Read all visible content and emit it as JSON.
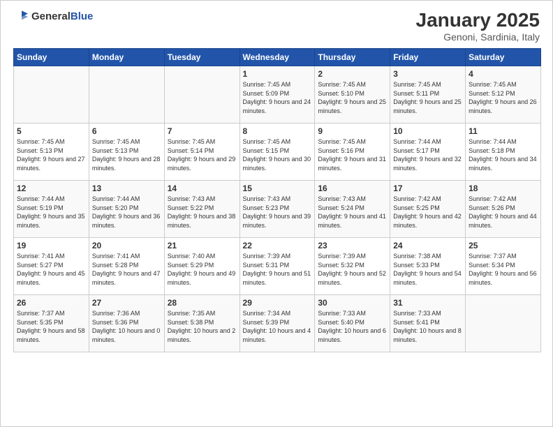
{
  "header": {
    "logo_general": "General",
    "logo_blue": "Blue",
    "month_title": "January 2025",
    "location": "Genoni, Sardinia, Italy"
  },
  "days_of_week": [
    "Sunday",
    "Monday",
    "Tuesday",
    "Wednesday",
    "Thursday",
    "Friday",
    "Saturday"
  ],
  "weeks": [
    [
      {
        "day": "",
        "content": ""
      },
      {
        "day": "",
        "content": ""
      },
      {
        "day": "",
        "content": ""
      },
      {
        "day": "1",
        "content": "Sunrise: 7:45 AM\nSunset: 5:09 PM\nDaylight: 9 hours\nand 24 minutes."
      },
      {
        "day": "2",
        "content": "Sunrise: 7:45 AM\nSunset: 5:10 PM\nDaylight: 9 hours\nand 25 minutes."
      },
      {
        "day": "3",
        "content": "Sunrise: 7:45 AM\nSunset: 5:11 PM\nDaylight: 9 hours\nand 25 minutes."
      },
      {
        "day": "4",
        "content": "Sunrise: 7:45 AM\nSunset: 5:12 PM\nDaylight: 9 hours\nand 26 minutes."
      }
    ],
    [
      {
        "day": "5",
        "content": "Sunrise: 7:45 AM\nSunset: 5:13 PM\nDaylight: 9 hours\nand 27 minutes."
      },
      {
        "day": "6",
        "content": "Sunrise: 7:45 AM\nSunset: 5:13 PM\nDaylight: 9 hours\nand 28 minutes."
      },
      {
        "day": "7",
        "content": "Sunrise: 7:45 AM\nSunset: 5:14 PM\nDaylight: 9 hours\nand 29 minutes."
      },
      {
        "day": "8",
        "content": "Sunrise: 7:45 AM\nSunset: 5:15 PM\nDaylight: 9 hours\nand 30 minutes."
      },
      {
        "day": "9",
        "content": "Sunrise: 7:45 AM\nSunset: 5:16 PM\nDaylight: 9 hours\nand 31 minutes."
      },
      {
        "day": "10",
        "content": "Sunrise: 7:44 AM\nSunset: 5:17 PM\nDaylight: 9 hours\nand 32 minutes."
      },
      {
        "day": "11",
        "content": "Sunrise: 7:44 AM\nSunset: 5:18 PM\nDaylight: 9 hours\nand 34 minutes."
      }
    ],
    [
      {
        "day": "12",
        "content": "Sunrise: 7:44 AM\nSunset: 5:19 PM\nDaylight: 9 hours\nand 35 minutes."
      },
      {
        "day": "13",
        "content": "Sunrise: 7:44 AM\nSunset: 5:20 PM\nDaylight: 9 hours\nand 36 minutes."
      },
      {
        "day": "14",
        "content": "Sunrise: 7:43 AM\nSunset: 5:22 PM\nDaylight: 9 hours\nand 38 minutes."
      },
      {
        "day": "15",
        "content": "Sunrise: 7:43 AM\nSunset: 5:23 PM\nDaylight: 9 hours\nand 39 minutes."
      },
      {
        "day": "16",
        "content": "Sunrise: 7:43 AM\nSunset: 5:24 PM\nDaylight: 9 hours\nand 41 minutes."
      },
      {
        "day": "17",
        "content": "Sunrise: 7:42 AM\nSunset: 5:25 PM\nDaylight: 9 hours\nand 42 minutes."
      },
      {
        "day": "18",
        "content": "Sunrise: 7:42 AM\nSunset: 5:26 PM\nDaylight: 9 hours\nand 44 minutes."
      }
    ],
    [
      {
        "day": "19",
        "content": "Sunrise: 7:41 AM\nSunset: 5:27 PM\nDaylight: 9 hours\nand 45 minutes."
      },
      {
        "day": "20",
        "content": "Sunrise: 7:41 AM\nSunset: 5:28 PM\nDaylight: 9 hours\nand 47 minutes."
      },
      {
        "day": "21",
        "content": "Sunrise: 7:40 AM\nSunset: 5:29 PM\nDaylight: 9 hours\nand 49 minutes."
      },
      {
        "day": "22",
        "content": "Sunrise: 7:39 AM\nSunset: 5:31 PM\nDaylight: 9 hours\nand 51 minutes."
      },
      {
        "day": "23",
        "content": "Sunrise: 7:39 AM\nSunset: 5:32 PM\nDaylight: 9 hours\nand 52 minutes."
      },
      {
        "day": "24",
        "content": "Sunrise: 7:38 AM\nSunset: 5:33 PM\nDaylight: 9 hours\nand 54 minutes."
      },
      {
        "day": "25",
        "content": "Sunrise: 7:37 AM\nSunset: 5:34 PM\nDaylight: 9 hours\nand 56 minutes."
      }
    ],
    [
      {
        "day": "26",
        "content": "Sunrise: 7:37 AM\nSunset: 5:35 PM\nDaylight: 9 hours\nand 58 minutes."
      },
      {
        "day": "27",
        "content": "Sunrise: 7:36 AM\nSunset: 5:36 PM\nDaylight: 10 hours\nand 0 minutes."
      },
      {
        "day": "28",
        "content": "Sunrise: 7:35 AM\nSunset: 5:38 PM\nDaylight: 10 hours\nand 2 minutes."
      },
      {
        "day": "29",
        "content": "Sunrise: 7:34 AM\nSunset: 5:39 PM\nDaylight: 10 hours\nand 4 minutes."
      },
      {
        "day": "30",
        "content": "Sunrise: 7:33 AM\nSunset: 5:40 PM\nDaylight: 10 hours\nand 6 minutes."
      },
      {
        "day": "31",
        "content": "Sunrise: 7:33 AM\nSunset: 5:41 PM\nDaylight: 10 hours\nand 8 minutes."
      },
      {
        "day": "",
        "content": ""
      }
    ]
  ]
}
